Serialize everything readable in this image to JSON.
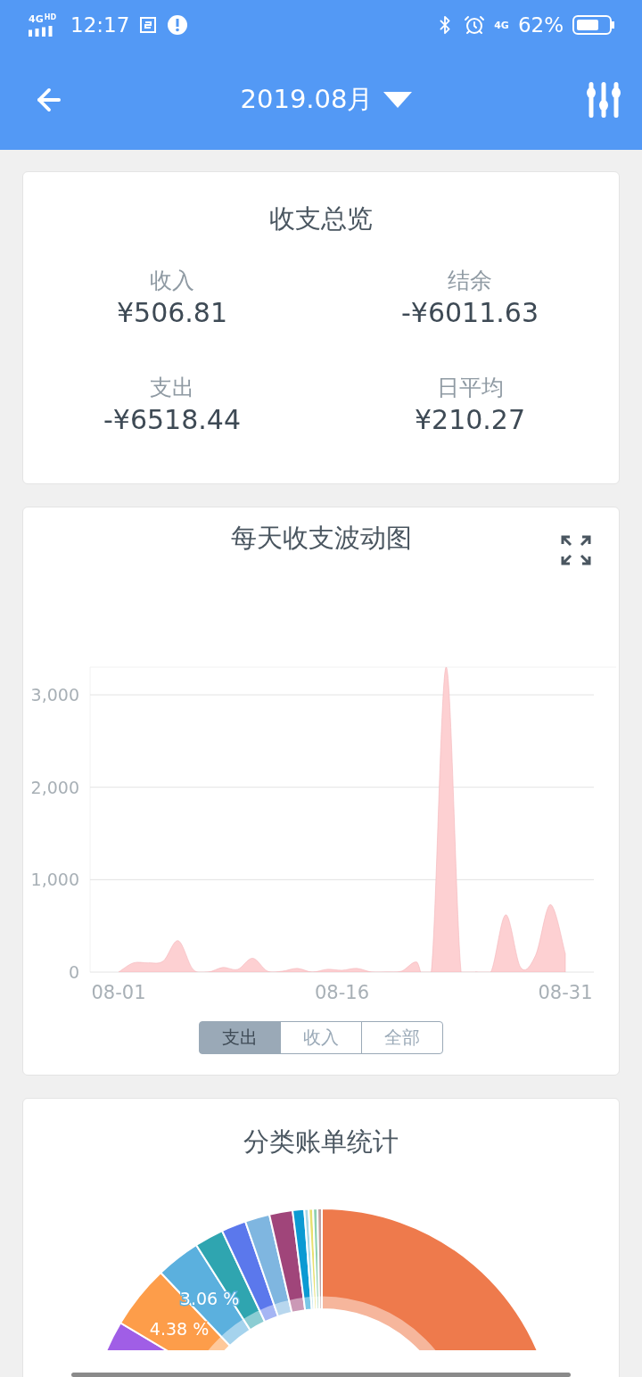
{
  "status_bar": {
    "network": "4G",
    "network_badge": "HD",
    "time": "12:17",
    "data_network": "4G",
    "battery": "62%"
  },
  "header": {
    "title": "2019.08月"
  },
  "overview": {
    "title": "收支总览",
    "items": [
      {
        "label": "收入",
        "value": "¥506.81"
      },
      {
        "label": "结余",
        "value": "-¥6011.63"
      },
      {
        "label": "支出",
        "value": "-¥6518.44"
      },
      {
        "label": "日平均",
        "value": "¥210.27"
      }
    ]
  },
  "daily_chart": {
    "title": "每天收支波动图",
    "chart_data": {
      "type": "area",
      "categories": [
        "08-01",
        null,
        null,
        null,
        null,
        null,
        null,
        null,
        null,
        null,
        null,
        null,
        null,
        null,
        null,
        "08-16",
        null,
        null,
        null,
        null,
        null,
        null,
        null,
        null,
        null,
        null,
        null,
        null,
        null,
        null,
        "08-31"
      ],
      "series": [
        {
          "color": "#fdd0d2",
          "values": [
            0,
            100,
            100,
            120,
            340,
            30,
            0,
            50,
            30,
            150,
            10,
            10,
            40,
            0,
            30,
            20,
            40,
            0,
            0,
            10,
            110,
            0,
            3300,
            0,
            0,
            0,
            620,
            50,
            180,
            730,
            200
          ]
        }
      ],
      "grid": true,
      "ylim": [
        0,
        3300
      ],
      "yticks": [
        {
          "value": 0,
          "label": "0"
        },
        {
          "value": 1000,
          "label": "1,000"
        },
        {
          "value": 2000,
          "label": "2,000"
        },
        {
          "value": 3000,
          "label": "3,000"
        }
      ]
    },
    "toggles": [
      {
        "label": "支出",
        "selected": true
      },
      {
        "label": "收入",
        "selected": false
      },
      {
        "label": "全部",
        "selected": false
      }
    ]
  },
  "category_chart": {
    "title": "分类账单统计",
    "chart_data": {
      "type": "donut",
      "values": [
        45,
        38.56,
        4.38,
        3.06,
        2,
        1.7,
        1.7,
        1.6,
        0.8,
        0.3,
        0.3,
        0.3,
        0.3
      ],
      "colors": [
        "#ee7a4c",
        "#a05ee6",
        "#fd9d4a",
        "#5bb0de",
        "#2fa5b0",
        "#5b78ec",
        "#7fb6e0",
        "#a0457a",
        "#0b9ad3",
        "#a8d8e8",
        "#e8e070",
        "#8fd0b0",
        "#c0a0a0"
      ],
      "value_labels": [
        null,
        null,
        "4.38 %",
        "3.06 %",
        null,
        null,
        null,
        null,
        null,
        null,
        null,
        null,
        null
      ]
    }
  }
}
